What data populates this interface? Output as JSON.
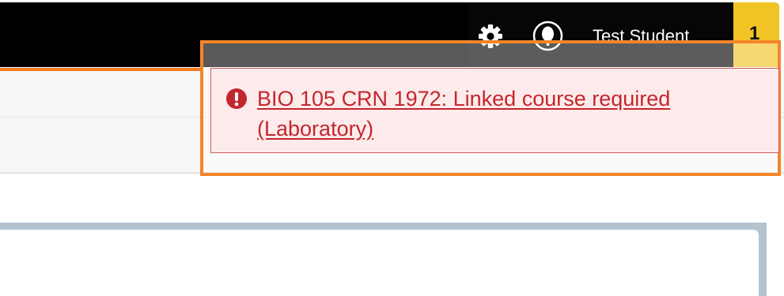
{
  "header": {
    "user_name": "Test Student",
    "notification_count": "1",
    "icons": {
      "settings": "gear-icon",
      "profile": "user-avatar-icon"
    }
  },
  "alert": {
    "type": "error",
    "icon": "error-exclamation-icon",
    "message": "BIO 105 CRN 1972: Linked course required (Laboratory)"
  },
  "colors": {
    "topbar": "#000000",
    "accent_orange": "#f47b20",
    "badge_yellow": "#f2c325",
    "alert_background": "#fdebeb",
    "alert_text": "#c4262e",
    "panel_border": "#b5c2cf"
  }
}
